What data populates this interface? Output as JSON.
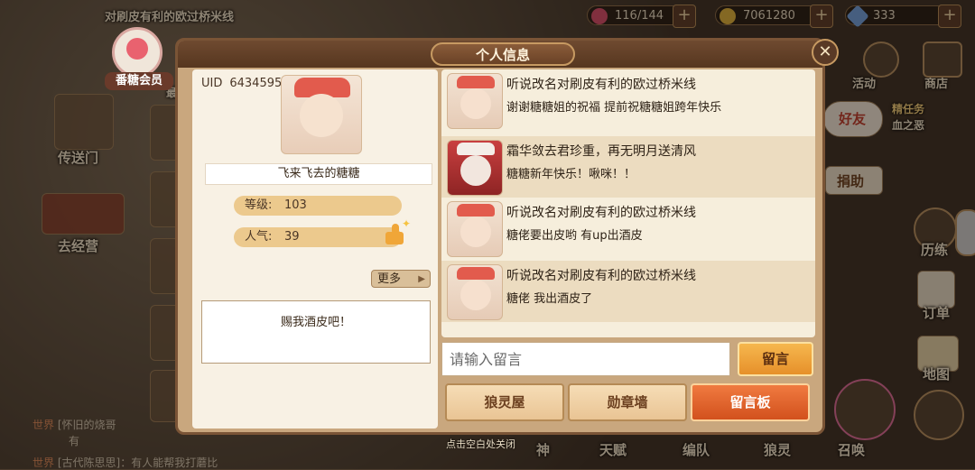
{
  "background": {
    "top_banner_text": "对刷皮有利的欧过桥米线",
    "resources": [
      {
        "icon": "heart-icon",
        "value": "116/144"
      },
      {
        "icon": "coin-icon",
        "value": "7061280"
      },
      {
        "icon": "diamond-icon",
        "value": "333"
      }
    ],
    "vip_label": "番糖会员",
    "left_menu": [
      "传送门",
      "去经营"
    ],
    "right_menu": [
      "活动",
      "商店",
      "好友",
      "捐助",
      "历练",
      "订单",
      "地图"
    ],
    "task_text": "精任务",
    "task_sub": "血之恶",
    "bottom_menu": [
      "神",
      "天赋",
      "编队",
      "狼灵",
      "召唤"
    ],
    "chat": [
      {
        "channel": "世界",
        "text": "[怀旧的烧哥",
        "extra": "有"
      },
      {
        "channel": "世界",
        "text": "[古代陈思思]：有人能帮我打蘑比"
      }
    ],
    "recent_label": "最近"
  },
  "dialog": {
    "title": "个人信息",
    "close_hint": "点击空白处关闭"
  },
  "profile": {
    "uid_label": "UID",
    "uid": "6434595",
    "name": "飞来飞去的糖糖",
    "level_label": "等级:",
    "level": "103",
    "popularity_label": "人气:",
    "popularity": "39",
    "more_label": "更多",
    "signature": "赐我酒皮吧！"
  },
  "messages": [
    {
      "author": "听说改名对刷皮有利的欧过桥米线",
      "content": "谢谢糖糖姐的祝福 提前祝糖糖姐跨年快乐",
      "avatar": "fox-mask-girl"
    },
    {
      "author": "霜华敛去君珍重，再无明月送清风",
      "content": "糖糖新年快乐！啾咪！！",
      "avatar": "red-hair-girl"
    },
    {
      "author": "听说改名对刷皮有利的欧过桥米线",
      "content": "糖佬要出皮哟 有up出酒皮",
      "avatar": "fox-mask-girl"
    },
    {
      "author": "听说改名对刷皮有利的欧过桥米线",
      "content": "糖佬 我出酒皮了",
      "avatar": "fox-mask-girl"
    }
  ],
  "input": {
    "placeholder": "请输入留言"
  },
  "leave_button": "留言",
  "tabs": [
    {
      "label": "狼灵屋",
      "active": false
    },
    {
      "label": "勋章墙",
      "active": false
    },
    {
      "label": "留言板",
      "active": true
    }
  ]
}
